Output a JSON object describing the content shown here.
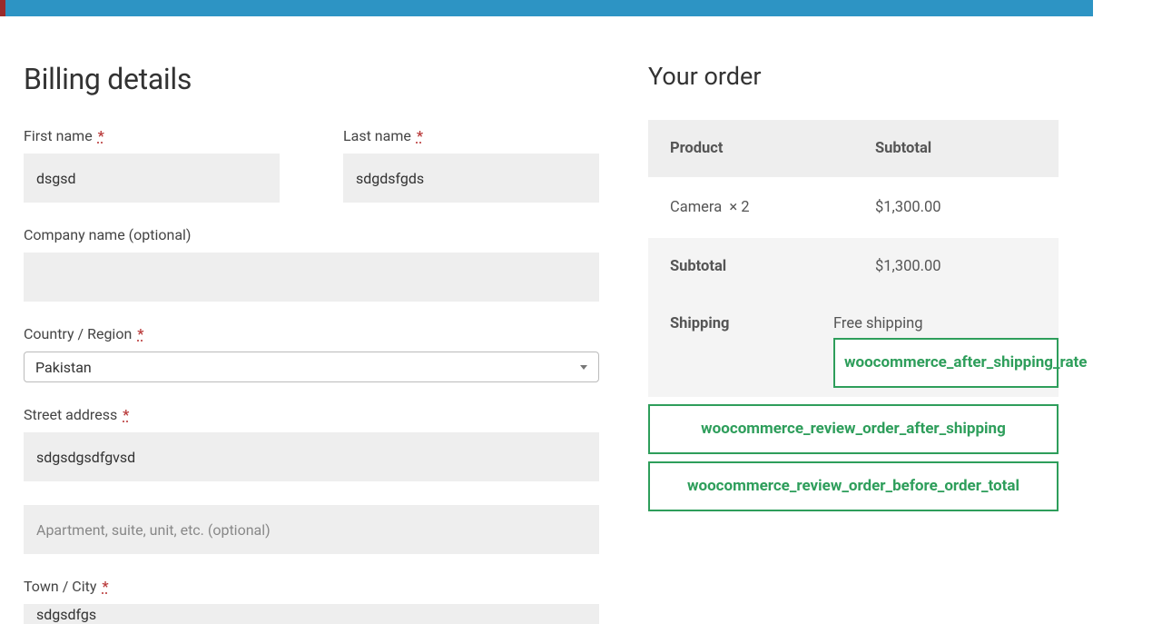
{
  "billing": {
    "heading": "Billing details",
    "first_name_label": "First name",
    "first_name_value": "dsgsd",
    "last_name_label": "Last name",
    "last_name_value": "sdgdsfgds",
    "company_label": "Company name (optional)",
    "company_value": "",
    "country_label": "Country / Region",
    "country_value": "Pakistan",
    "street_label": "Street address",
    "street_value": "sdgsdgsdfgvsd",
    "street2_placeholder": "Apartment, suite, unit, etc. (optional)",
    "street2_value": "",
    "city_label": "Town / City",
    "city_value": "sdgsdfgs",
    "required_mark": "*"
  },
  "order": {
    "heading": "Your order",
    "col_product": "Product",
    "col_subtotal": "Subtotal",
    "item_name": "Camera",
    "item_qty_prefix": "× ",
    "item_qty": "2",
    "item_subtotal": "$1,300.00",
    "subtotal_label": "Subtotal",
    "subtotal_value": "$1,300.00",
    "shipping_label": "Shipping",
    "shipping_value": "Free shipping"
  },
  "hooks": {
    "after_shipping_rate": "woocommerce_after_shipping_rate",
    "review_after_shipping": "woocommerce_review_order_after_shipping",
    "review_before_total": "woocommerce_review_order_before_order_total"
  }
}
